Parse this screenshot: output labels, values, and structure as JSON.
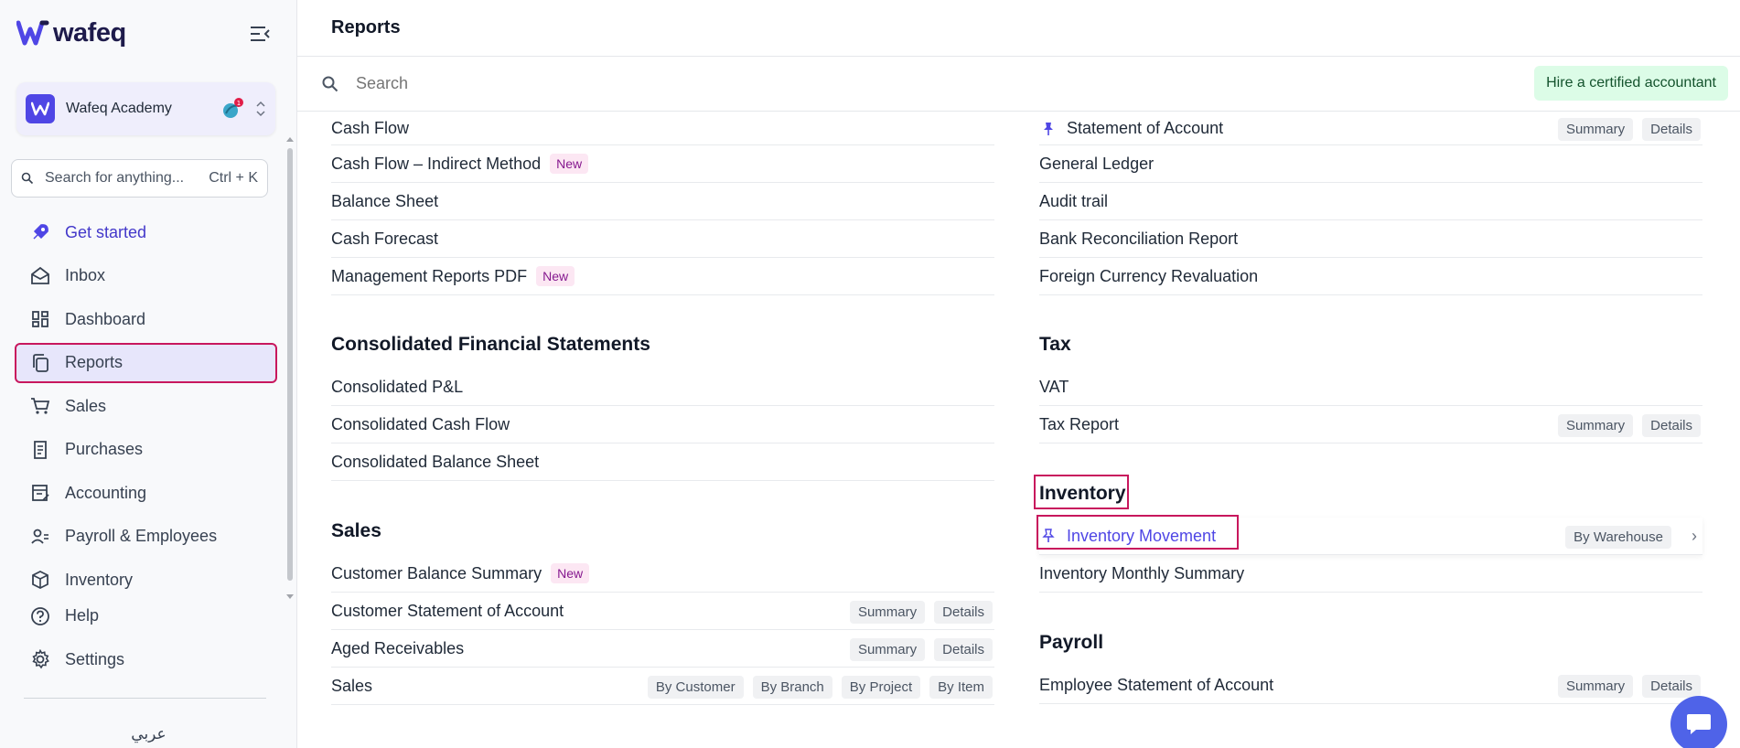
{
  "sidebar": {
    "brand": "wafeq",
    "org_name": "Wafeq Academy",
    "search_placeholder": "Search for anything...",
    "search_shortcut": "Ctrl + K",
    "items": [
      {
        "label": "Get started",
        "icon": "rocket-icon"
      },
      {
        "label": "Inbox",
        "icon": "inbox-icon"
      },
      {
        "label": "Dashboard",
        "icon": "dashboard-icon"
      },
      {
        "label": "Reports",
        "icon": "reports-icon"
      },
      {
        "label": "Sales",
        "icon": "cart-icon"
      },
      {
        "label": "Purchases",
        "icon": "receipt-icon"
      },
      {
        "label": "Accounting",
        "icon": "ledger-icon"
      },
      {
        "label": "Payroll & Employees",
        "icon": "people-icon"
      },
      {
        "label": "Inventory",
        "icon": "box-icon"
      },
      {
        "label": "Help",
        "icon": "help-icon"
      },
      {
        "label": "Settings",
        "icon": "gear-icon"
      }
    ],
    "language": "عربي"
  },
  "header": {
    "title": "Reports",
    "search_placeholder": "Search",
    "hire_label": "Hire a certified accountant"
  },
  "left": {
    "top_rows": [
      {
        "label": "Cash Flow"
      },
      {
        "label": "Cash Flow – Indirect Method",
        "badge": "New"
      },
      {
        "label": "Balance Sheet"
      },
      {
        "label": "Cash Forecast"
      },
      {
        "label": "Management Reports PDF",
        "badge": "New"
      }
    ],
    "consolidated": {
      "title": "Consolidated Financial Statements",
      "rows": [
        "Consolidated P&L",
        "Consolidated Cash Flow",
        "Consolidated Balance Sheet"
      ]
    },
    "sales": {
      "title": "Sales",
      "rows": [
        {
          "label": "Customer Balance Summary",
          "badge": "New"
        },
        {
          "label": "Customer Statement of Account",
          "pills": [
            "Summary",
            "Details"
          ]
        },
        {
          "label": "Aged Receivables",
          "pills": [
            "Summary",
            "Details"
          ]
        },
        {
          "label": "Sales",
          "pills": [
            "By Customer",
            "By Branch",
            "By Project",
            "By Item"
          ]
        }
      ]
    }
  },
  "right": {
    "top_rows": [
      {
        "label": "Statement of Account",
        "pinned": true,
        "pills": [
          "Summary",
          "Details"
        ]
      },
      {
        "label": "General Ledger"
      },
      {
        "label": "Audit trail"
      },
      {
        "label": "Bank Reconciliation Report"
      },
      {
        "label": "Foreign Currency Revaluation"
      }
    ],
    "tax": {
      "title": "Tax",
      "rows": [
        {
          "label": "VAT"
        },
        {
          "label": "Tax Report",
          "pills": [
            "Summary",
            "Details"
          ]
        }
      ]
    },
    "inventory": {
      "title": "Inventory",
      "rows": [
        {
          "label": "Inventory Movement",
          "pinned": true,
          "pills": [
            "By Warehouse"
          ]
        },
        {
          "label": "Inventory Monthly Summary"
        }
      ]
    },
    "payroll": {
      "title": "Payroll",
      "rows": [
        {
          "label": "Employee Statement of Account",
          "pills": [
            "Summary",
            "Details"
          ]
        }
      ]
    }
  },
  "colors": {
    "accent": "#4f46e5",
    "highlight_border": "#c8175d",
    "hire_bg": "#dcfce7",
    "new_badge_bg": "#fce7f3"
  }
}
